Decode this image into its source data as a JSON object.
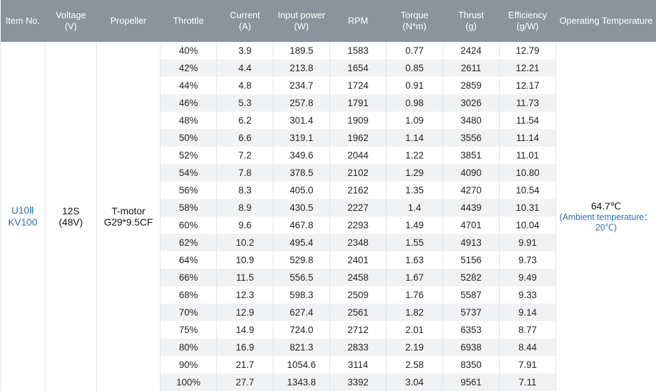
{
  "headers": [
    {
      "line1": "Item No.",
      "line2": ""
    },
    {
      "line1": "Voltage",
      "line2": "(V)"
    },
    {
      "line1": "Propeller",
      "line2": ""
    },
    {
      "line1": "Throttle",
      "line2": ""
    },
    {
      "line1": "Current",
      "line2": "(A)"
    },
    {
      "line1": "Input power",
      "line2": "(W)"
    },
    {
      "line1": "RPM",
      "line2": ""
    },
    {
      "line1": "Torque",
      "line2": "(N*m)"
    },
    {
      "line1": "Thrust",
      "line2": "(g)"
    },
    {
      "line1": "Efficiency",
      "line2": "(g/W)"
    },
    {
      "line1": "Operating Temperature",
      "line2": ""
    }
  ],
  "item_no": {
    "line1": "U10Ⅱ",
    "line2": "KV100"
  },
  "voltage": {
    "line1": "12S",
    "line2": "(48V)"
  },
  "propeller": {
    "line1": "T-motor",
    "line2": "G29*9.5CF"
  },
  "operating_temperature": {
    "value": "64.7℃",
    "ambient": "(Ambient temperature：20℃)"
  },
  "rows": [
    [
      "40%",
      "3.9",
      "189.5",
      "1583",
      "0.77",
      "2424",
      "12.79"
    ],
    [
      "42%",
      "4.4",
      "213.8",
      "1654",
      "0.85",
      "2611",
      "12.21"
    ],
    [
      "44%",
      "4.8",
      "234.7",
      "1724",
      "0.91",
      "2859",
      "12.17"
    ],
    [
      "46%",
      "5.3",
      "257.8",
      "1791",
      "0.98",
      "3026",
      "11.73"
    ],
    [
      "48%",
      "6.2",
      "301.4",
      "1909",
      "1.09",
      "3480",
      "11.54"
    ],
    [
      "50%",
      "6.6",
      "319.1",
      "1962",
      "1.14",
      "3556",
      "11.14"
    ],
    [
      "52%",
      "7.2",
      "349.6",
      "2044",
      "1.22",
      "3851",
      "11.01"
    ],
    [
      "54%",
      "7.8",
      "378.5",
      "2102",
      "1.29",
      "4090",
      "10.80"
    ],
    [
      "56%",
      "8.3",
      "405.0",
      "2162",
      "1.35",
      "4270",
      "10.54"
    ],
    [
      "58%",
      "8.9",
      "430.5",
      "2227",
      "1.4",
      "4439",
      "10.31"
    ],
    [
      "60%",
      "9.6",
      "467.8",
      "2293",
      "1.49",
      "4701",
      "10.04"
    ],
    [
      "62%",
      "10.2",
      "495.4",
      "2348",
      "1.55",
      "4913",
      "9.91"
    ],
    [
      "64%",
      "10.9",
      "529.8",
      "2401",
      "1.63",
      "5156",
      "9.73"
    ],
    [
      "66%",
      "11.5",
      "556.5",
      "2458",
      "1.67",
      "5282",
      "9.49"
    ],
    [
      "68%",
      "12.3",
      "598.3",
      "2509",
      "1.76",
      "5587",
      "9.33"
    ],
    [
      "70%",
      "12.9",
      "627.4",
      "2561",
      "1.82",
      "5737",
      "9.14"
    ],
    [
      "75%",
      "14.9",
      "724.0",
      "2712",
      "2.01",
      "6353",
      "8.77"
    ],
    [
      "80%",
      "16.9",
      "821.3",
      "2833",
      "2.19",
      "6938",
      "8.44"
    ],
    [
      "90%",
      "21.7",
      "1054.6",
      "3114",
      "2.58",
      "8350",
      "7.91"
    ],
    [
      "100%",
      "27.7",
      "1343.8",
      "3392",
      "3.04",
      "9561",
      "7.11"
    ]
  ]
}
